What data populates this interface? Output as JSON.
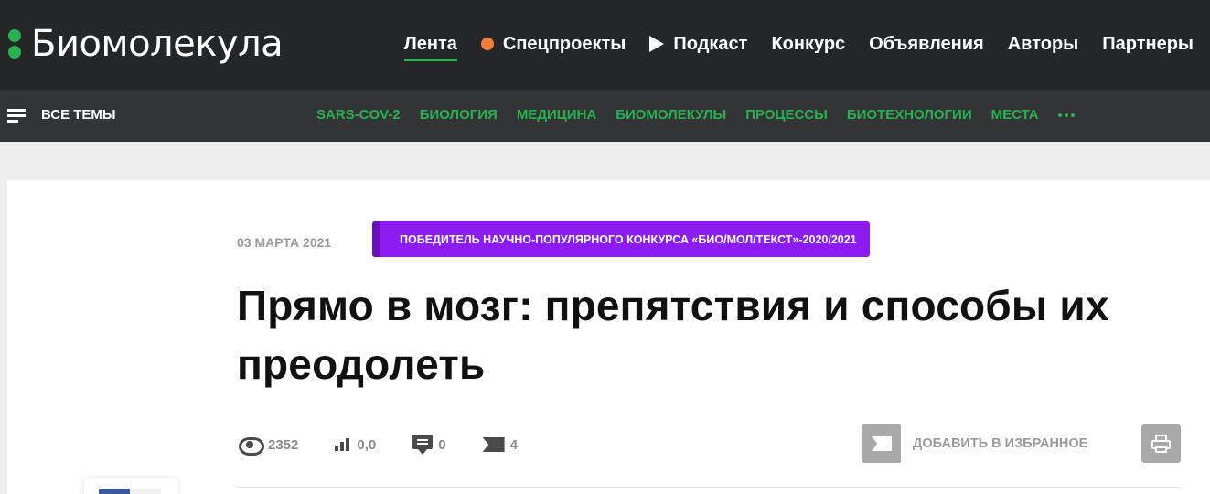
{
  "header": {
    "logo_text": "Биомолекула",
    "nav": [
      {
        "label": "Лента",
        "active": true
      },
      {
        "label": "Спецпроекты",
        "icon": "orange-dot-icon"
      },
      {
        "label": "Подкаст",
        "icon": "play-icon"
      },
      {
        "label": "Конкурс"
      },
      {
        "label": "Объявления"
      },
      {
        "label": "Авторы"
      },
      {
        "label": "Партнеры"
      }
    ]
  },
  "topics": {
    "all_label": "ВСЕ ТЕМЫ",
    "items": [
      "SARS-COV-2",
      "БИОЛОГИЯ",
      "МЕДИЦИНА",
      "БИОМОЛЕКУЛЫ",
      "ПРОЦЕССЫ",
      "БИОТЕХНОЛОГИИ",
      "МЕСТА"
    ],
    "more_icon": "ellipsis-icon"
  },
  "article": {
    "date": "03 МАРТА 2021",
    "badge": "ПОБЕДИТЕЛЬ НАУЧНО-ПОПУЛЯРНОГО КОНКУРСА «БИО/МОЛ/ТЕКСТ»-2020/2021",
    "title": "Прямо в мозг: препятствия и способы их преодолеть",
    "stats": {
      "views": "2352",
      "rating": "0,0",
      "comments": "0",
      "bookmarks": "4"
    },
    "favorite_label": "ДОБАВИТЬ В ИЗБРАННОЕ"
  },
  "colors": {
    "header_bg": "#252628",
    "topics_bg": "#333436",
    "accent_green": "#27b14f",
    "badge_purple": "#8c1cf2",
    "orange": "#f07e3a"
  }
}
